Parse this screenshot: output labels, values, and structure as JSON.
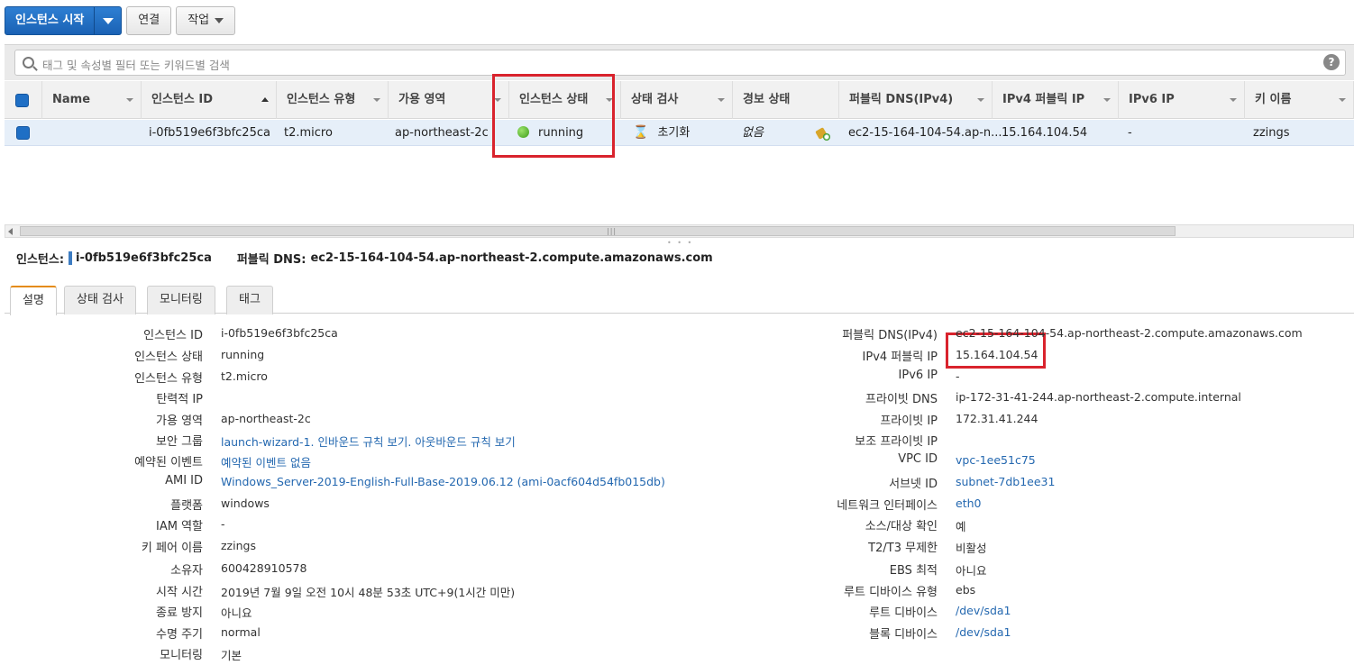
{
  "toolbar": {
    "launch": "인스턴스 시작",
    "connect": "연결",
    "actions": "작업"
  },
  "search": {
    "placeholder": "태그 및 속성별 필터 또는 키워드별 검색"
  },
  "table": {
    "headers": [
      "Name",
      "인스턴스 ID",
      "인스턴스 유형",
      "가용 영역",
      "인스턴스 상태",
      "상태 검사",
      "경보 상태",
      "퍼블릭 DNS(IPv4)",
      "IPv4 퍼블릭 IP",
      "IPv6 IP",
      "키 이름"
    ],
    "row": {
      "name": "",
      "instance_id": "i-0fb519e6f3bfc25ca",
      "instance_type": "t2.micro",
      "zone": "ap-northeast-2c",
      "state": "running",
      "status_check": "초기화",
      "alarm": "없음",
      "public_dns": "ec2-15-164-104-54.ap-n...",
      "ipv4": "15.164.104.54",
      "ipv6": "-",
      "key": "zzings"
    }
  },
  "detail_header": {
    "instance_label": "인스턴스:",
    "instance_id": "i-0fb519e6f3bfc25ca",
    "dns_label": "퍼블릭 DNS:",
    "dns": "ec2-15-164-104-54.ap-northeast-2.compute.amazonaws.com"
  },
  "tabs": [
    "설명",
    "상태 검사",
    "모니터링",
    "태그"
  ],
  "left_details": [
    {
      "label": "인스턴스 ID",
      "value": "i-0fb519e6f3bfc25ca"
    },
    {
      "label": "인스턴스 상태",
      "value": "running"
    },
    {
      "label": "인스턴스 유형",
      "value": "t2.micro"
    },
    {
      "label": "탄력적 IP",
      "value": ""
    },
    {
      "label": "가용 영역",
      "value": "ap-northeast-2c"
    },
    {
      "label": "보안 그룹",
      "value": "launch-wizard-1. 인바운드 규칙 보기. 아웃바운드 규칙 보기"
    },
    {
      "label": "예약된 이벤트",
      "value": "예약된 이벤트 없음"
    },
    {
      "label": "AMI ID",
      "value": "Windows_Server-2019-English-Full-Base-2019.06.12 (ami-0acf604d54fb015db)"
    },
    {
      "label": "플랫폼",
      "value": "windows"
    },
    {
      "label": "IAM 역할",
      "value": "-"
    },
    {
      "label": "키 페어 이름",
      "value": "zzings"
    },
    {
      "label": "소유자",
      "value": "600428910578"
    },
    {
      "label": "시작 시간",
      "value": "2019년 7월 9일 오전 10시 48분 53초 UTC+9(1시간 미만)"
    },
    {
      "label": "종료 방지",
      "value": "아니요"
    },
    {
      "label": "수명 주기",
      "value": "normal"
    },
    {
      "label": "모니터링",
      "value": "기본"
    }
  ],
  "right_details": [
    {
      "label": "퍼블릭 DNS(IPv4)",
      "value": "ec2-15-164-104-54.ap-northeast-2.compute.amazonaws.com"
    },
    {
      "label": "IPv4 퍼블릭 IP",
      "value": "15.164.104.54"
    },
    {
      "label": "IPv6 IP",
      "value": "-"
    },
    {
      "label": "프라이빗 DNS",
      "value": "ip-172-31-41-244.ap-northeast-2.compute.internal"
    },
    {
      "label": "프라이빗 IP",
      "value": "172.31.41.244"
    },
    {
      "label": "보조 프라이빗 IP",
      "value": ""
    },
    {
      "label": "VPC ID",
      "value": "vpc-1ee51c75"
    },
    {
      "label": "서브넷 ID",
      "value": "subnet-7db1ee31"
    },
    {
      "label": "네트워크 인터페이스",
      "value": "eth0"
    },
    {
      "label": "소스/대상 확인",
      "value": "예"
    },
    {
      "label": "T2/T3 무제한",
      "value": "비활성"
    },
    {
      "label": "EBS 최적",
      "value": "아니요"
    },
    {
      "label": "루트 디바이스 유형",
      "value": "ebs"
    },
    {
      "label": "루트 디바이스",
      "value": "/dev/sda1"
    },
    {
      "label": "블록 디바이스",
      "value": "/dev/sda1"
    }
  ]
}
